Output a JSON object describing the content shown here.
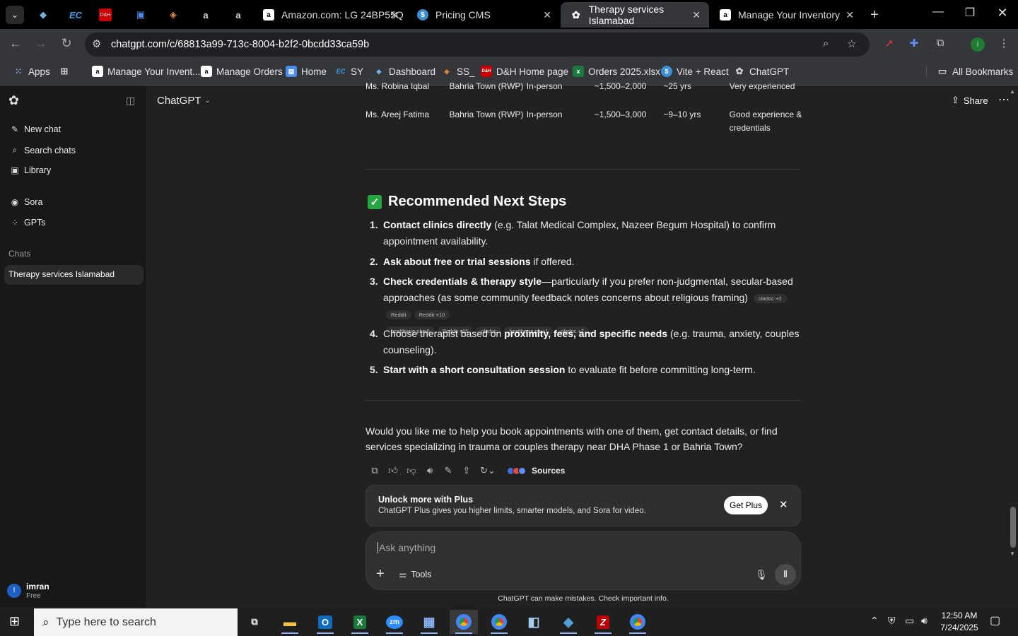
{
  "browser": {
    "tabs": [
      {
        "title": "Amazon.com: LG 24BP55Q",
        "active": false
      },
      {
        "title": "Pricing CMS",
        "active": false
      },
      {
        "title": "Therapy services Islamabad",
        "active": true
      },
      {
        "title": "Manage Your Inventory",
        "active": false
      }
    ],
    "pinned_tabs": [
      "EC",
      "D&H",
      "a",
      "a"
    ],
    "url": "chatgpt.com/c/68813a99-713c-8004-b2f2-0bcdd33ca59b",
    "bookmarks": [
      "Apps",
      "Manage Your Invent...",
      "Manage Orders",
      "Home",
      "SY",
      "Dashboard",
      "SS_",
      "D&H Home page",
      "Orders 2025.xlsx",
      "Vite + React",
      "ChatGPT"
    ],
    "all_bookmarks": "All Bookmarks"
  },
  "sidebar": {
    "new_chat": "New chat",
    "search_chats": "Search chats",
    "library": "Library",
    "sora": "Sora",
    "gpts": "GPTs",
    "chats_heading": "Chats",
    "chats": [
      "Therapy services Islamabad"
    ],
    "user": {
      "name": "imran",
      "plan": "Free",
      "initial": "I"
    }
  },
  "header": {
    "model": "ChatGPT",
    "share": "Share"
  },
  "table_rows": [
    {
      "name": "Ms. Robina Iqbal",
      "location": "Bahria Town (RWP)",
      "mode": "In-person",
      "fee": "~1,500–2,000",
      "experience": "~25 yrs",
      "note": "Very experienced"
    },
    {
      "name": "Ms. Areej Fatima",
      "location": "Bahria Town (RWP)",
      "mode": "In-person",
      "fee": "~1,500–3,000",
      "experience": "~9–10 yrs",
      "note": "Good experience & credentials"
    }
  ],
  "steps": {
    "title": "Recommended Next Steps",
    "items": [
      {
        "num": "1.",
        "bold": "Contact clinics directly",
        "rest": " (e.g. Talat Medical Complex, Nazeer Begum Hospital) to confirm appointment availability."
      },
      {
        "num": "2.",
        "bold": "Ask about free or trial sessions",
        "rest": " if offered."
      },
      {
        "num": "3.",
        "bold": "Check credentials & therapy style",
        "rest": "—particularly if you prefer non-judgmental, secular-based approaches (as some community feedback notes concerns about religious framing)"
      },
      {
        "num": "4.",
        "pre": "Choose therapist based on ",
        "bold": "proximity, fees, and specific needs",
        "rest": " (e.g. trauma, anxiety, couples counseling)."
      },
      {
        "num": "5.",
        "bold": "Start with a short consultation session",
        "rest": " to evaluate fit before committing long-term."
      }
    ],
    "chips_line1": [
      "oladoc +2",
      "Reddit",
      "Reddit +10"
    ],
    "chips_line2": [
      "healthwire.pk +6",
      "Reddit +15",
      "oladoc",
      "healthwire.pk +1",
      "oladoc +2"
    ]
  },
  "closing": "Would you like me to help you book appointments with one of them, get contact details, or find services specializing in trauma or couples therapy near DHA Phase 1 or Bahria Town?",
  "sources_label": "Sources",
  "plus_banner": {
    "title": "Unlock more with Plus",
    "body": "ChatGPT Plus gives you higher limits, smarter models, and Sora for video.",
    "button": "Get Plus"
  },
  "composer": {
    "placeholder": "Ask anything",
    "tools": "Tools"
  },
  "disclaimer": "ChatGPT can make mistakes. Check important info.",
  "taskbar": {
    "search_placeholder": "Type here to search",
    "time": "12:50 AM",
    "date": "7/24/2025"
  }
}
